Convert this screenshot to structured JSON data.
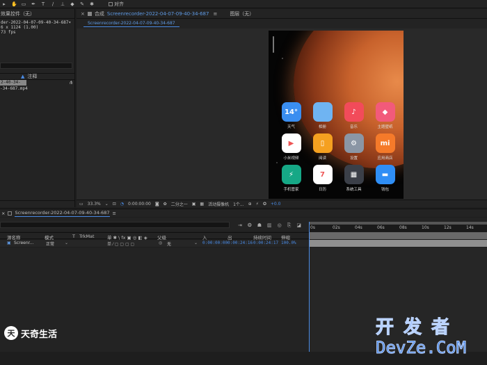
{
  "toolbar": {
    "align_label": "对齐"
  },
  "project": {
    "header": "效果控件（无）",
    "info_name": "der-2022-04-07-09-40-34-687▾",
    "info_dims": "6 x 1124 (1.00)",
    "info_fps": "73 fps",
    "col_note": "注释",
    "row1": "2-40-34-687",
    "row2": "-34-687.mp4"
  },
  "comp": {
    "tab_label": "合成",
    "tab_name": "Screenrecorder-2022-04-07-09-40-34-687",
    "layer_label": "图层（无）",
    "sub_tab": "Screenrecorder-2022-04-07-09-40-34-687",
    "zoom": "33.3%",
    "timecode": "0:00:00:00",
    "res": "二分之一",
    "camera": "活动摄像机",
    "views": "1个...",
    "exposure": "+0.0"
  },
  "phone": {
    "apps": [
      {
        "label": "天气",
        "icon": "14°",
        "color": "#3a8ef0"
      },
      {
        "label": "相册",
        "icon": "",
        "color": "#6fb4f2"
      },
      {
        "label": "音乐",
        "icon": "♪",
        "color": "#f24b5a"
      },
      {
        "label": "主题壁纸",
        "icon": "◆",
        "color": "#f25a7a"
      },
      {
        "label": "小米视频",
        "icon": "▶",
        "color": "#ffffff"
      },
      {
        "label": "阅读",
        "icon": "▯",
        "color": "#f5a020"
      },
      {
        "label": "设置",
        "icon": "⚙",
        "color": "#8b96a5"
      },
      {
        "label": "应用商店",
        "icon": "mi",
        "color": "#f57a2a"
      },
      {
        "label": "手机管家",
        "icon": "⚡",
        "color": "#16a886"
      },
      {
        "label": "日历",
        "icon": "7",
        "color": "#ffffff"
      },
      {
        "label": "系统工具",
        "icon": "▦",
        "color": "#3b3f48"
      },
      {
        "label": "钱包",
        "icon": "▬",
        "color": "#2f8ef5"
      }
    ]
  },
  "timeline": {
    "tab_name": "Screenrecorder-2022-04-07-09-40-34-687",
    "ticks": [
      "0s",
      "02s",
      "04s",
      "06s",
      "08s",
      "10s",
      "12s",
      "14s"
    ],
    "cols": {
      "source_name": "源名称",
      "mode": "模式",
      "t": "T",
      "trkmat": "TrkMat",
      "parent": "父级",
      "in": "入",
      "out": "出",
      "duration": "持续时间",
      "stretch": "伸缩"
    },
    "row": {
      "name": "Screenr...",
      "mode": "正常",
      "parent": "无",
      "in": "0:00:00:00",
      "out": "0:00:24:16",
      "duration": "0:00:24:17",
      "stretch": "100.0%"
    }
  },
  "watermark": {
    "left": "天奇生活",
    "left_logo": "天",
    "right_cn": "开发者",
    "right_en": "DevZe.CoM"
  }
}
